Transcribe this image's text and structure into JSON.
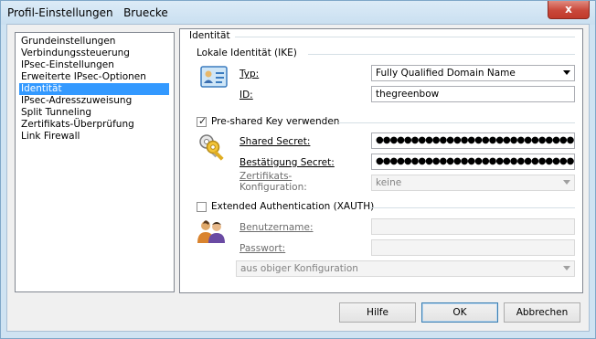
{
  "window": {
    "title": "Profil-Einstellungen",
    "profile_name": "Bruecke",
    "close_glyph": "x"
  },
  "tree": {
    "items": [
      {
        "label": "Grundeinstellungen",
        "selected": false
      },
      {
        "label": "Verbindungssteuerung",
        "selected": false
      },
      {
        "label": "IPsec-Einstellungen",
        "selected": false
      },
      {
        "label": "Erweiterte IPsec-Optionen",
        "selected": false
      },
      {
        "label": "Identität",
        "selected": true
      },
      {
        "label": "IPsec-Adresszuweisung",
        "selected": false
      },
      {
        "label": "Split Tunneling",
        "selected": false
      },
      {
        "label": "Zertifikats-Überprüfung",
        "selected": false
      },
      {
        "label": "Link Firewall",
        "selected": false
      }
    ]
  },
  "identity": {
    "section_title": "Identität",
    "local_identity": {
      "group_title": "Lokale Identität (IKE)",
      "type_label": "Typ:",
      "type_value": "Fully Qualified Domain Name",
      "id_label": "ID:",
      "id_value": "thegreenbow",
      "icon": "id-card-icon"
    },
    "psk": {
      "checkbox_label": "Pre-shared Key verwenden",
      "checked": true,
      "shared_secret_label": "Shared Secret:",
      "shared_secret_value": "●●●●●●●●●●●●●●●●●●●●●●●●●●●●●●",
      "confirm_label": "Bestätigung Secret:",
      "confirm_value": "●●●●●●●●●●●●●●●●●●●●●●●●●●●●●●",
      "cert_config_label_1": "Zertifikats-",
      "cert_config_label_2": "Konfiguration:",
      "cert_config_value": "keine",
      "icon": "keys-icon"
    },
    "xauth": {
      "checkbox_label": "Extended Authentication (XAUTH)",
      "checked": false,
      "username_label": "Benutzername:",
      "username_value": "",
      "password_label": "Passwort:",
      "password_value": "",
      "source_value": "aus obiger Konfiguration",
      "icon": "users-icon"
    }
  },
  "buttons": {
    "help": "Hilfe",
    "ok": "OK",
    "cancel": "Abbrechen"
  }
}
